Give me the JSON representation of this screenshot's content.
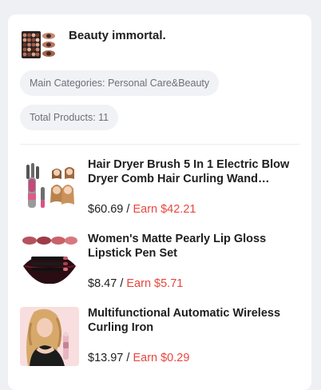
{
  "store": {
    "name": "Beauty immortal.",
    "logo_icon": "eyeshadow-palette-icon"
  },
  "chips": {
    "main_categories": "Main Categories: Personal Care&Beauty",
    "total_products": "Total Products: 11"
  },
  "colors": {
    "earn": "#e8463f",
    "chip_bg": "#f1f2f5",
    "chip_text": "#6b6f77"
  },
  "products": [
    {
      "title": "Hair Dryer Brush 5 In 1 Electric Blow Dryer Comb Hair Curling Wand…",
      "price": "$60.69",
      "separator": "/",
      "earn": "Earn $42.21",
      "thumb_icon": "hair-dryer-brush-icon"
    },
    {
      "title": "Women's Matte Pearly Lip Gloss Lipstick Pen Set",
      "price": "$8.47",
      "separator": "/",
      "earn": "Earn $5.71",
      "thumb_icon": "lipstick-set-icon"
    },
    {
      "title": "Multifunctional Automatic Wireless Curling Iron",
      "price": "$13.97",
      "separator": "/",
      "earn": "Earn $0.29",
      "thumb_icon": "curling-iron-icon"
    }
  ]
}
